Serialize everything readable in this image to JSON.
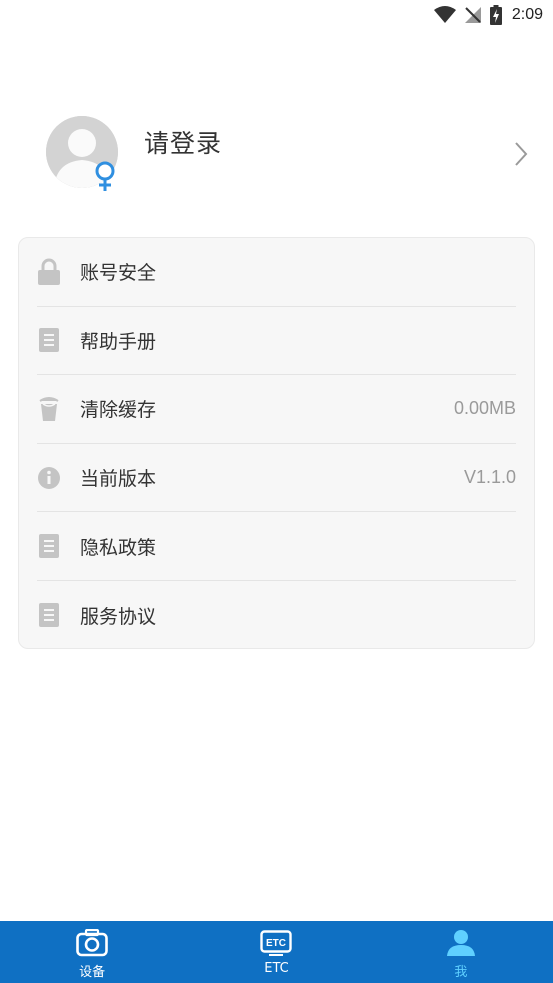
{
  "status_bar": {
    "time": "2:09",
    "icons": [
      "wifi-icon",
      "no-signal-icon",
      "battery-charging-icon"
    ]
  },
  "profile": {
    "login_prompt": "请登录",
    "avatar_icon": "default-avatar-icon",
    "gender_icon": "female-icon",
    "chevron_icon": "chevron-right-icon"
  },
  "settings": {
    "items": [
      {
        "label": "账号安全",
        "icon": "lock-icon",
        "value": ""
      },
      {
        "label": "帮助手册",
        "icon": "document-icon",
        "value": ""
      },
      {
        "label": "清除缓存",
        "icon": "trash-icon",
        "value": "0.00MB"
      },
      {
        "label": "当前版本",
        "icon": "info-icon",
        "value": "V1.1.0"
      },
      {
        "label": "隐私政策",
        "icon": "document-icon",
        "value": ""
      },
      {
        "label": "服务协议",
        "icon": "document-icon",
        "value": ""
      }
    ]
  },
  "bottom_nav": {
    "items": [
      {
        "label": "设备",
        "icon": "camera-icon",
        "active": false
      },
      {
        "label": "ETC",
        "icon": "etc-icon",
        "active": false
      },
      {
        "label": "我",
        "icon": "person-icon",
        "active": true
      }
    ]
  },
  "colors": {
    "nav_background": "#0f70c3",
    "nav_active": "#5fd0ff",
    "gender_icon": "#2f8fe0",
    "icon_gray": "#c4c4c4",
    "card_background": "#f7f7f7"
  }
}
